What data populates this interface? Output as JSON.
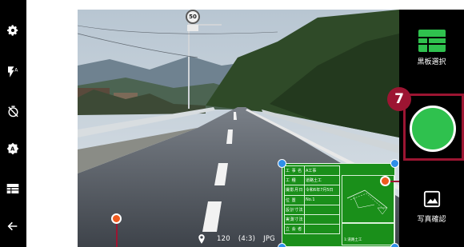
{
  "left_toolbar": {
    "icons": [
      "settings-icon",
      "flash-auto-icon",
      "timer-off-icon",
      "auto-mode-icon",
      "blackboard-icon",
      "back-arrow-icon"
    ]
  },
  "camera": {
    "speed_sign": "50",
    "info": {
      "location_icon": "location-pin-icon",
      "resolution": "120",
      "aspect": "(4:3)",
      "format": "JPG"
    }
  },
  "board": {
    "rows": [
      {
        "key": "工 事 名",
        "value": "A工事"
      },
      {
        "key": "工 種",
        "value": "道路土工"
      },
      {
        "key": "撮影月日",
        "value": "令和6年7月5日"
      },
      {
        "key": "位 置",
        "value": "No.1"
      },
      {
        "key": "設計寸法",
        "value": ""
      },
      {
        "key": "実測寸法",
        "value": ""
      },
      {
        "key": "立 会 者",
        "value": ""
      }
    ],
    "note": "1:道路土工"
  },
  "right_panel": {
    "board_select_label": "黒板選択",
    "photo_check_label": "写真確認"
  },
  "callouts": {
    "number": "7"
  },
  "colors": {
    "accent_green": "#2fc14e",
    "board_green": "#1a8f1a",
    "callout_red": "#9c1532",
    "handle_blue": "#2f8fe8",
    "marker_orange": "#ef5a1e"
  }
}
